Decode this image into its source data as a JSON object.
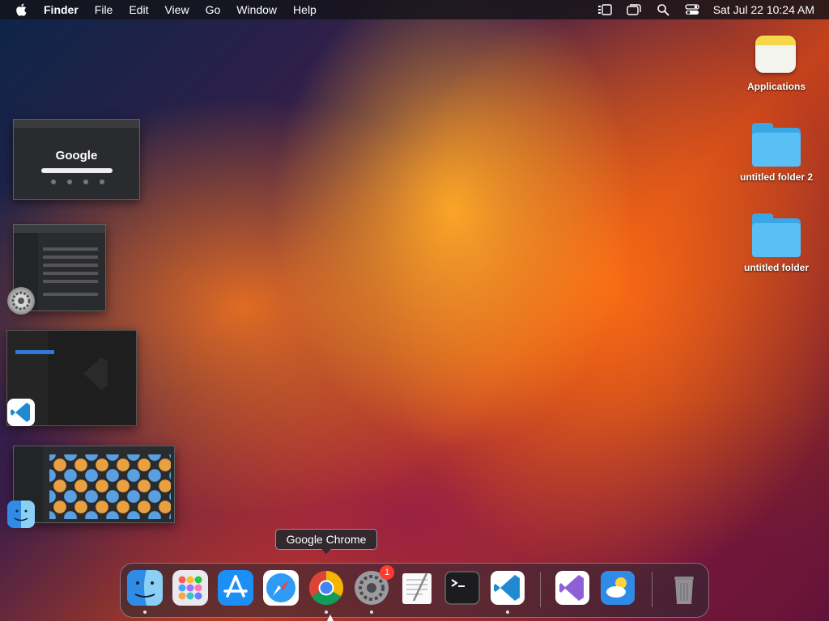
{
  "menubar": {
    "app_name": "Finder",
    "items": [
      "File",
      "Edit",
      "View",
      "Go",
      "Window",
      "Help"
    ],
    "clock": "Sat Jul 22  10:24 AM",
    "status_icons": [
      "stage-manager-icon",
      "window-switch-icon",
      "spotlight-search-icon",
      "control-center-icon"
    ]
  },
  "desktop": {
    "icons": [
      {
        "label": "Applications",
        "icon": "applications-icon"
      },
      {
        "label": "untitled folder 2",
        "icon": "folder-icon"
      },
      {
        "label": "untitled folder",
        "icon": "folder-icon"
      }
    ]
  },
  "thumbnails": {
    "chrome_logo_text": "Google"
  },
  "tooltip": {
    "text": "Google Chrome"
  },
  "dock": {
    "apps": [
      "finder-icon",
      "launchpad-icon",
      "app-store-icon",
      "safari-icon",
      "chrome-icon",
      "system-settings-icon",
      "textedit-icon",
      "terminal-icon",
      "vscode-icon",
      "visual-studio-icon",
      "weather-icon",
      "trash-icon"
    ],
    "settings_badge": "1"
  },
  "colors": {
    "folder_blue": "#58c0f5",
    "badge_red": "#ff3b30",
    "vscode_blue": "#1f8ad2"
  }
}
